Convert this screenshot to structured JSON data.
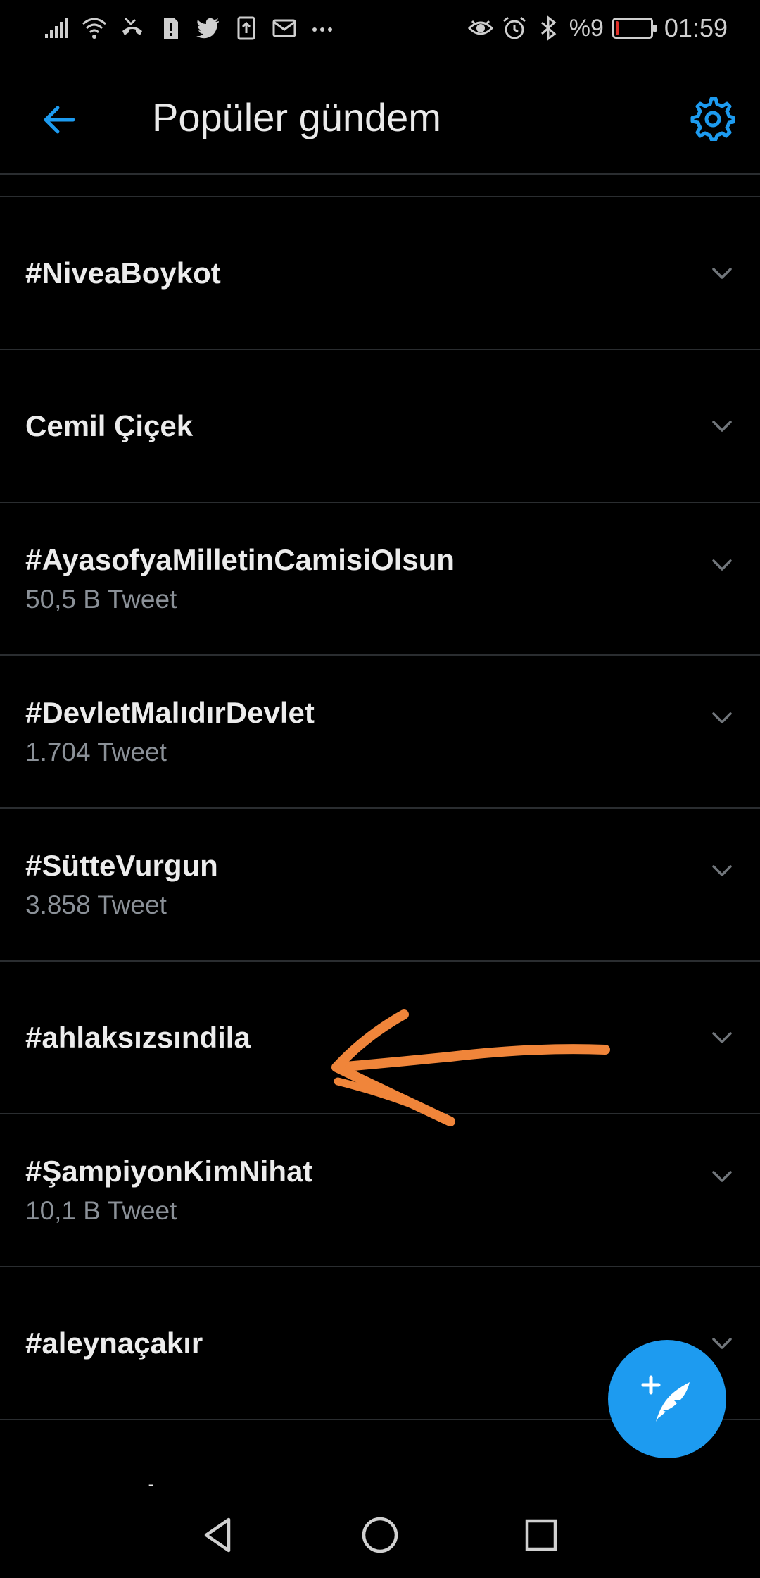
{
  "status_bar": {
    "battery_text": "%9",
    "clock": "01:59",
    "battery_level": 0.09,
    "left_icons": [
      "signal-icon",
      "wifi-icon",
      "missed-call-icon",
      "sim-alert-icon",
      "twitter-icon",
      "upload-icon",
      "mail-icon",
      "more-dots-icon"
    ],
    "right_icons": [
      "eye-icon",
      "alarm-icon",
      "bluetooth-icon",
      "battery-icon"
    ]
  },
  "header": {
    "title": "Popüler gündem",
    "back_icon": "arrow-left-icon",
    "settings_icon": "gear-icon"
  },
  "trends": [
    {
      "name": "#NiveaBoykot",
      "count": ""
    },
    {
      "name": "Cemil Çiçek",
      "count": ""
    },
    {
      "name": "#AyasofyaMilletinCamisiOlsun",
      "count": "50,5 B Tweet"
    },
    {
      "name": "#DevletMalıdırDevlet",
      "count": "1.704 Tweet"
    },
    {
      "name": "#SütteVurgun",
      "count": "3.858 Tweet"
    },
    {
      "name": "#ahlaksızsındila",
      "count": ""
    },
    {
      "name": "#ŞampiyonKimNihat",
      "count": "10,1 B Tweet"
    },
    {
      "name": "#aleynaçakır",
      "count": ""
    },
    {
      "name": "#BeyazShow",
      "count": ""
    }
  ],
  "fab": {
    "icon": "compose-tweet-icon"
  },
  "navbar": {
    "icons": [
      "back-triangle-icon",
      "home-circle-icon",
      "recents-square-icon"
    ]
  },
  "colors": {
    "accent": "#1d9bf0",
    "background": "#000000",
    "divider": "#2a2d30",
    "annotation_arrow": "#f0853a",
    "secondary_text": "#8b9198"
  }
}
